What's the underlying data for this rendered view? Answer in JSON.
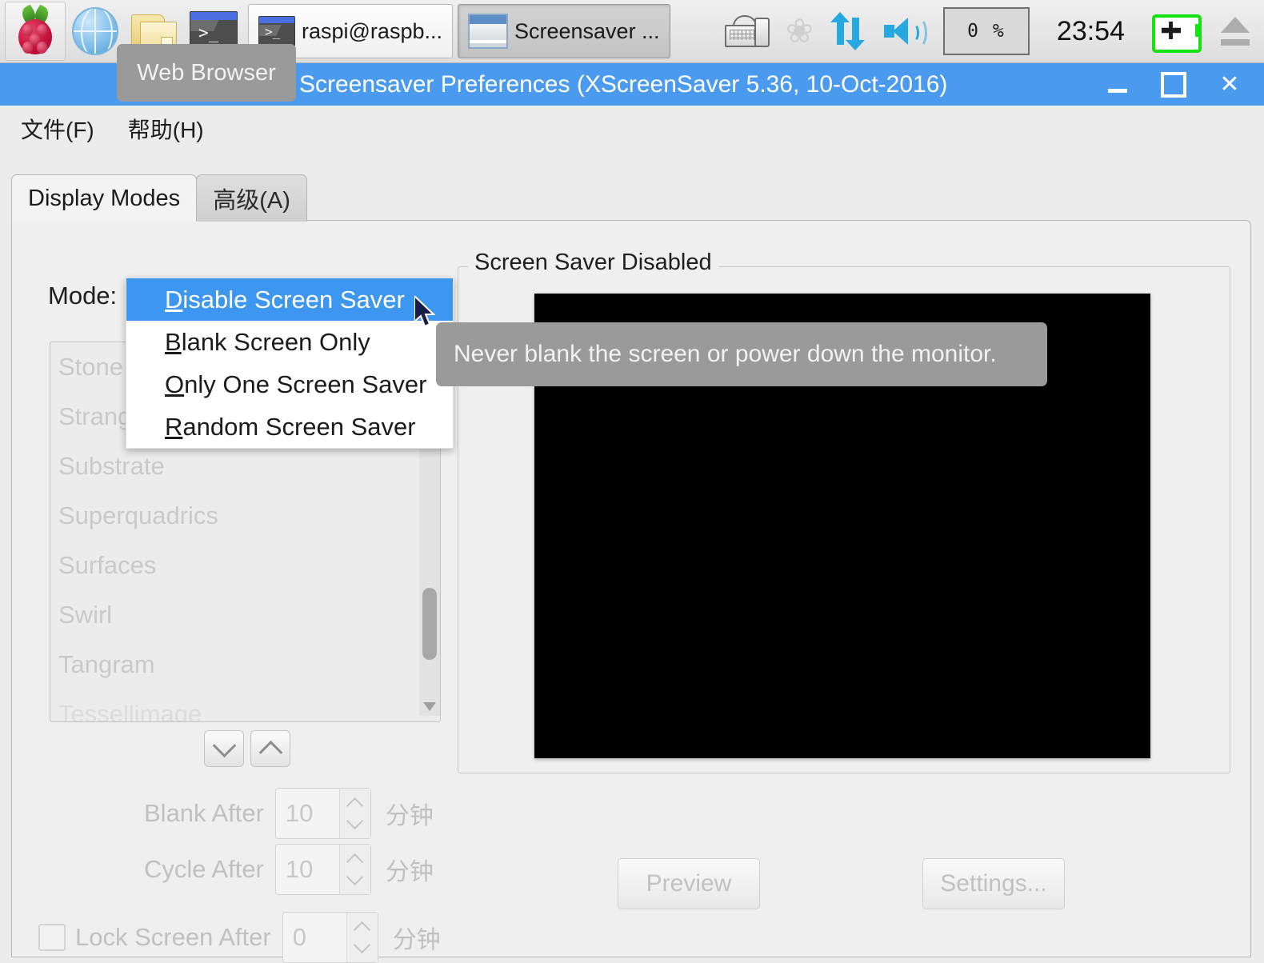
{
  "taskbar": {
    "launchers": [
      {
        "name": "raspberry-menu",
        "icon": "raspberry-icon"
      },
      {
        "name": "web-browser",
        "icon": "globe-icon"
      },
      {
        "name": "file-manager",
        "icon": "folder-icon"
      },
      {
        "name": "terminal",
        "icon": "terminal-icon"
      }
    ],
    "windows": [
      {
        "label": "raspi@raspb...",
        "icon": "terminal-icon",
        "active": false
      },
      {
        "label": "Screensaver ...",
        "icon": "window-icon",
        "active": true
      }
    ],
    "tray": {
      "keyboard_icon": "keyboard-mouse-icon",
      "bluetooth_icon": "bluetooth-icon",
      "network_icon": "network-updown-icon",
      "volume_icon": "volume-icon",
      "cpu_label": "0 %",
      "clock": "23:54",
      "battery_icon": "battery-charging-icon",
      "eject_icon": "eject-icon"
    }
  },
  "window": {
    "title": "Screensaver Preferences  (XScreenSaver 5.36, 10-Oct-2016)",
    "controls": {
      "minimize": "_",
      "maximize": "□",
      "close": "✕"
    }
  },
  "menubar": {
    "items": [
      {
        "label": "文件(F)"
      },
      {
        "label": "帮助(H)"
      }
    ]
  },
  "tabs": [
    {
      "label": "Display Modes",
      "active": true
    },
    {
      "label": "高级(A)",
      "active": false
    }
  ],
  "left_panel": {
    "mode_label": "Mode:",
    "saver_list": [
      "Stone",
      "Strange",
      "Substrate",
      "Superquadrics",
      "Surfaces",
      "Swirl",
      "Tangram",
      "Tessellimage"
    ],
    "sort_buttons": [
      {
        "name": "move-down-button",
        "icon": "chevron-down-icon"
      },
      {
        "name": "move-up-button",
        "icon": "chevron-up-icon"
      }
    ],
    "fields": [
      {
        "label": "Blank After",
        "value": "10",
        "unit": "分钟"
      },
      {
        "label": "Cycle After",
        "value": "10",
        "unit": "分钟"
      },
      {
        "label": "Lock Screen After",
        "value": "0",
        "unit": "分钟",
        "checkbox": true,
        "checked": false
      }
    ]
  },
  "right_panel": {
    "group_title": "Screen Saver Disabled",
    "preview_button": "Preview",
    "settings_button": "Settings..."
  },
  "mode_menu": {
    "items": [
      {
        "accel": "D",
        "rest": "isable Screen Saver",
        "selected": true
      },
      {
        "accel": "B",
        "rest": "lank Screen Only",
        "selected": false
      },
      {
        "accel": "O",
        "rest": "nly One Screen Saver",
        "selected": false
      },
      {
        "accel": "R",
        "rest": "andom Screen Saver",
        "selected": false
      }
    ]
  },
  "tooltips": {
    "web_browser": "Web Browser",
    "mode_hint": "Never blank the screen or power down the monitor."
  },
  "colors": {
    "accent": "#4a9bf0",
    "menu_highlight": "#3d96f0",
    "tooltip_bg": "#9a9a9a",
    "window_bg": "#ececec",
    "preview_bg": "#000000"
  }
}
